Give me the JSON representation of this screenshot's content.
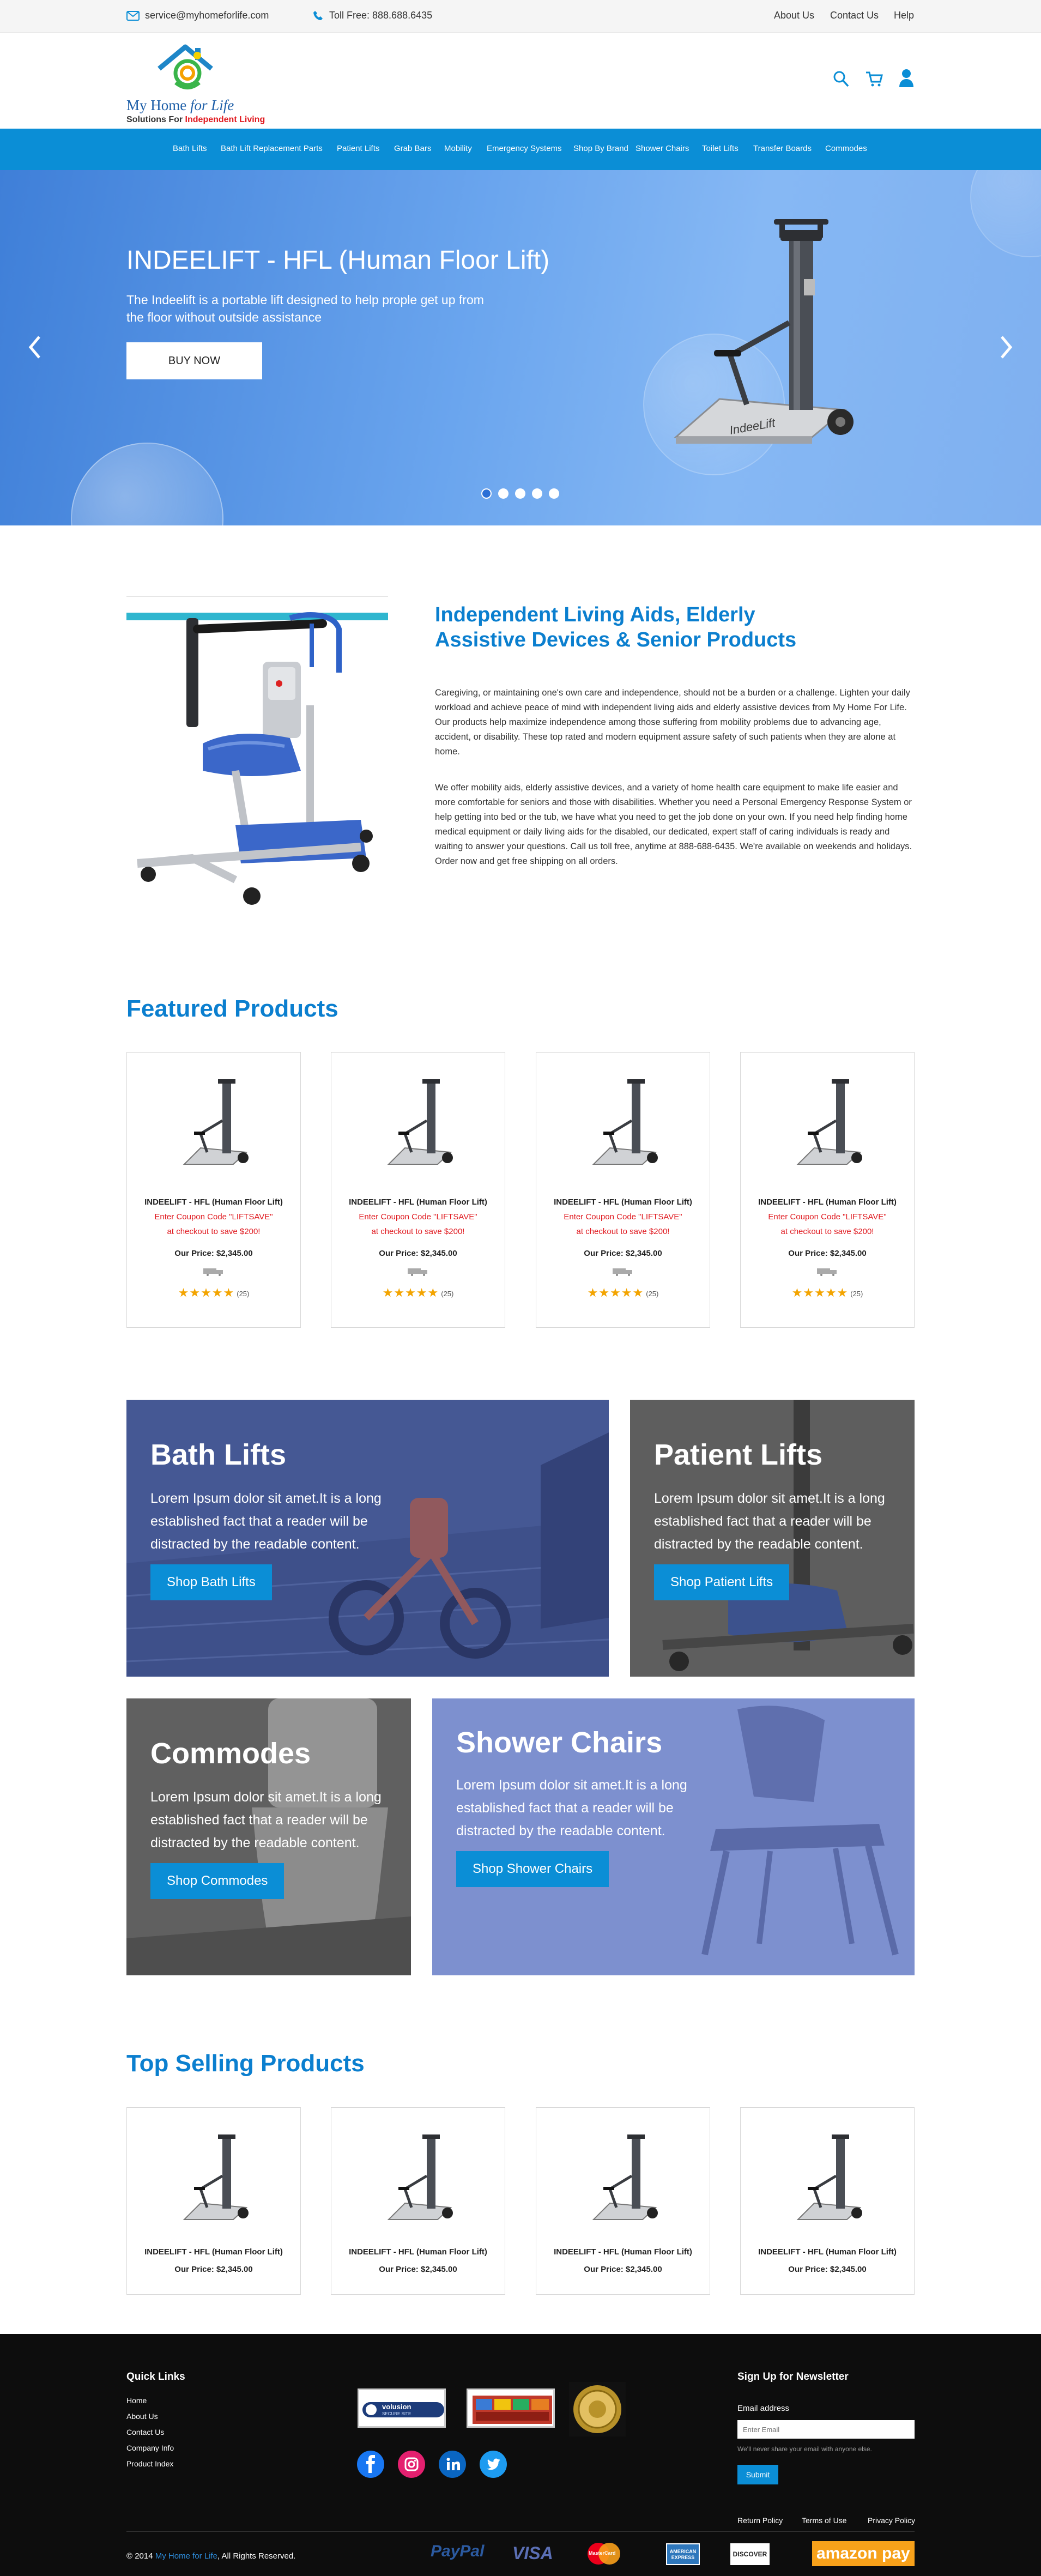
{
  "topbar": {
    "email": "service@myhomeforlife.com",
    "phone": "Toll Free: 888.688.6435",
    "links": [
      "About Us",
      "Contact Us",
      "Help"
    ]
  },
  "brand": {
    "name_main": "My Home ",
    "name_italic": "for Life",
    "tagline_a": "Solutions For ",
    "tagline_b": "Independent Living"
  },
  "nav": {
    "items": [
      "Bath Lifts",
      "Bath Lift Replacement Parts",
      "Patient Lifts",
      "Grab Bars",
      "Mobility",
      "Emergency Systems",
      "Shop By Brand",
      "Shower Chairs",
      "Toilet Lifts",
      "Transfer Boards",
      "Commodes"
    ]
  },
  "hero": {
    "title": "INDEELIFT - HFL (Human Floor Lift)",
    "subtitle": "The Indeelift is a portable lift designed to help prople get up from the floor without outside assistance",
    "button": "BUY NOW",
    "product_brand": "IndeeLift",
    "dots": 5,
    "active_dot": 0
  },
  "intro": {
    "heading": "Independent Living Aids, Elderly Assistive Devices & Senior Products",
    "para1": "Caregiving, or maintaining one's own care and independence, should not be a burden or a challenge. Lighten your daily workload and achieve peace of mind with independent living aids and elderly assistive devices from My Home For Life. Our products help maximize independence among those suffering from mobility problems due to advancing age, accident, or disability. These top rated and modern equipment assure safety of such patients when they are alone at home.",
    "para2": "We offer mobility aids, elderly assistive devices, and a variety of home health care equipment to make life easier and more comfortable for seniors and those with disabilities. Whether you need a Personal Emergency Response System or help getting into bed or the tub, we have what you need to get the job done on your own. If you need help finding home medical equipment or daily living aids for the disabled, our dedicated, expert staff of caring individuals is ready and waiting to answer your questions. Call us toll free, anytime at 888-688-6435. We're available on weekends and holidays. Order now and get free shipping on all orders."
  },
  "featured": {
    "heading": "Featured Products",
    "products": [
      {
        "name": "INDEELIFT - HFL (Human Floor Lift)",
        "promo1": "Enter Coupon Code \"LIFTSAVE\"",
        "promo2": "at checkout to save $200!",
        "price": "Our Price: $2,345.00",
        "stars": "★★★★★",
        "reviews": "(25)"
      },
      {
        "name": "INDEELIFT - HFL (Human Floor Lift)",
        "promo1": "Enter Coupon Code \"LIFTSAVE\"",
        "promo2": "at checkout to save $200!",
        "price": "Our Price: $2,345.00",
        "stars": "★★★★★",
        "reviews": "(25)"
      },
      {
        "name": "INDEELIFT - HFL (Human Floor Lift)",
        "promo1": "Enter Coupon Code \"LIFTSAVE\"",
        "promo2": "at checkout to save $200!",
        "price": "Our Price: $2,345.00",
        "stars": "★★★★★",
        "reviews": "(25)"
      },
      {
        "name": "INDEELIFT - HFL (Human Floor Lift)",
        "promo1": "Enter Coupon Code \"LIFTSAVE\"",
        "promo2": "at checkout to save $200!",
        "price": "Our Price: $2,345.00",
        "stars": "★★★★★",
        "reviews": "(25)"
      }
    ]
  },
  "categories": [
    {
      "title": "Bath Lifts",
      "text": "Lorem Ipsum dolor sit amet.It is a long established fact that a reader will be distracted by the readable content.",
      "button": "Shop Bath Lifts"
    },
    {
      "title": "Patient Lifts",
      "text": "Lorem Ipsum dolor sit amet.It is a long established fact that a reader will be distracted by the readable content.",
      "button": "Shop Patient Lifts"
    },
    {
      "title": "Commodes",
      "text": "Lorem Ipsum dolor sit amet.It is a long established fact that a reader will be distracted by the readable content.",
      "button": "Shop Commodes"
    },
    {
      "title": "Shower Chairs",
      "text": "Lorem Ipsum dolor sit amet.It is a long established fact that a reader will be distracted by the readable content.",
      "button": "Shop Shower Chairs"
    }
  ],
  "top_selling": {
    "heading": "Top Selling Products",
    "products": [
      {
        "name": "INDEELIFT - HFL (Human Floor Lift)",
        "price": "Our Price: $2,345.00"
      },
      {
        "name": "INDEELIFT - HFL (Human Floor Lift)",
        "price": "Our Price: $2,345.00"
      },
      {
        "name": "INDEELIFT - HFL (Human Floor Lift)",
        "price": "Our Price: $2,345.00"
      },
      {
        "name": "INDEELIFT - HFL (Human Floor Lift)",
        "price": "Our Price: $2,345.00"
      }
    ]
  },
  "footer": {
    "quick_links_title": "Quick Links",
    "quick_links": [
      "Home",
      "About Us",
      "Contact Us",
      "Company Info",
      "Product Index"
    ],
    "badge_volusion": "volusion",
    "badge_secure": "SECURE SITE",
    "newsletter_title": "Sign Up for Newsletter",
    "email_label": "Email address",
    "email_placeholder": "Enter Email",
    "email_help": "We'll never share your email with anyone else.",
    "submit": "Submit",
    "policy_links": [
      "Return Policy",
      "Terms of Use",
      "Privacy Policy"
    ],
    "copyright_a": "© 2014 ",
    "copyright_link": "My Home for Life",
    "copyright_b": ", All Rights Reserved.",
    "payments": [
      "PayPal",
      "VISA",
      "MasterCard",
      "AMERICAN EXPRESS",
      "DISCOVER",
      "amazon pay"
    ]
  },
  "colors": {
    "accent": "#0b8ed6",
    "heading_blue": "#0b7fcf",
    "promo_red": "#e0191f",
    "star": "#f3a400"
  }
}
